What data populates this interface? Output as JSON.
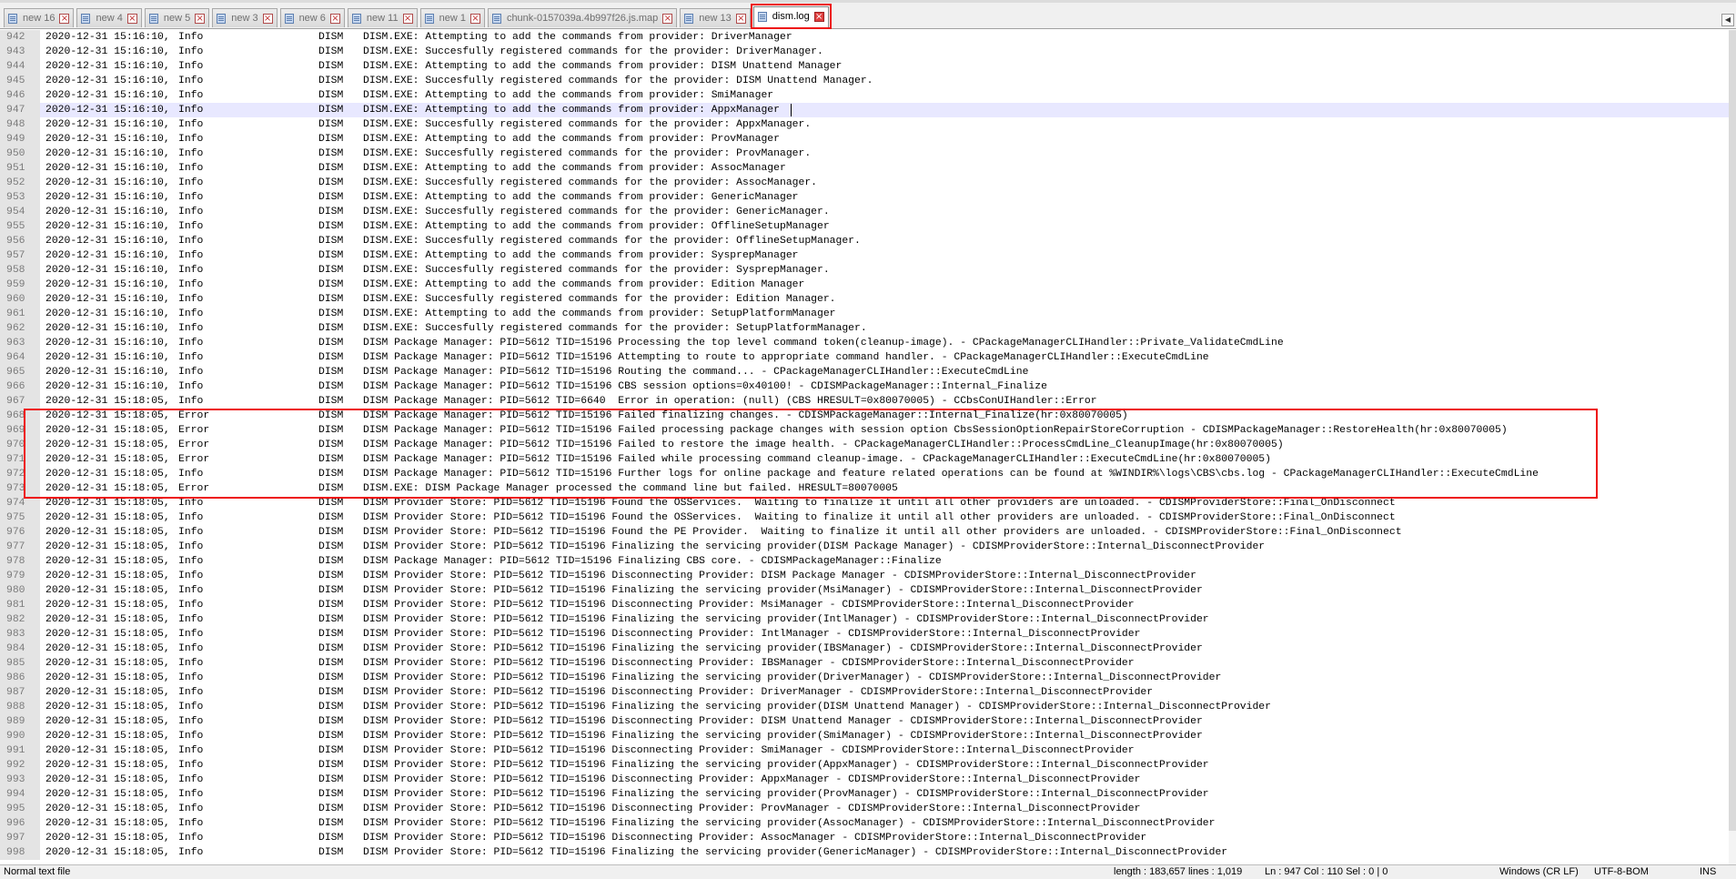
{
  "tabs": [
    {
      "label": "new 16",
      "active": false
    },
    {
      "label": "new 4",
      "active": false
    },
    {
      "label": "new 5",
      "active": false
    },
    {
      "label": "new 3",
      "active": false
    },
    {
      "label": "new 6",
      "active": false
    },
    {
      "label": "new 11",
      "active": false
    },
    {
      "label": "new 1",
      "active": false
    },
    {
      "label": "chunk-0157039a.4b997f26.js.map",
      "active": false
    },
    {
      "label": "new 13",
      "active": false
    },
    {
      "label": "dism.log",
      "active": true
    }
  ],
  "editor": {
    "current_line": 947,
    "lines": [
      {
        "n": "942",
        "dt": "2020-12-31 15:16:10,",
        "lv": "Info",
        "src": "DISM",
        "msg": "DISM.EXE: Attempting to add the commands from provider: DriverManager"
      },
      {
        "n": "943",
        "dt": "2020-12-31 15:16:10,",
        "lv": "Info",
        "src": "DISM",
        "msg": "DISM.EXE: Succesfully registered commands for the provider: DriverManager."
      },
      {
        "n": "944",
        "dt": "2020-12-31 15:16:10,",
        "lv": "Info",
        "src": "DISM",
        "msg": "DISM.EXE: Attempting to add the commands from provider: DISM Unattend Manager"
      },
      {
        "n": "945",
        "dt": "2020-12-31 15:16:10,",
        "lv": "Info",
        "src": "DISM",
        "msg": "DISM.EXE: Succesfully registered commands for the provider: DISM Unattend Manager."
      },
      {
        "n": "946",
        "dt": "2020-12-31 15:16:10,",
        "lv": "Info",
        "src": "DISM",
        "msg": "DISM.EXE: Attempting to add the commands from provider: SmiManager"
      },
      {
        "n": "947",
        "dt": "2020-12-31 15:16:10,",
        "lv": "Info",
        "src": "DISM",
        "msg": "DISM.EXE: Attempting to add the commands from provider: AppxManager"
      },
      {
        "n": "948",
        "dt": "2020-12-31 15:16:10,",
        "lv": "Info",
        "src": "DISM",
        "msg": "DISM.EXE: Succesfully registered commands for the provider: AppxManager."
      },
      {
        "n": "949",
        "dt": "2020-12-31 15:16:10,",
        "lv": "Info",
        "src": "DISM",
        "msg": "DISM.EXE: Attempting to add the commands from provider: ProvManager"
      },
      {
        "n": "950",
        "dt": "2020-12-31 15:16:10,",
        "lv": "Info",
        "src": "DISM",
        "msg": "DISM.EXE: Succesfully registered commands for the provider: ProvManager."
      },
      {
        "n": "951",
        "dt": "2020-12-31 15:16:10,",
        "lv": "Info",
        "src": "DISM",
        "msg": "DISM.EXE: Attempting to add the commands from provider: AssocManager"
      },
      {
        "n": "952",
        "dt": "2020-12-31 15:16:10,",
        "lv": "Info",
        "src": "DISM",
        "msg": "DISM.EXE: Succesfully registered commands for the provider: AssocManager."
      },
      {
        "n": "953",
        "dt": "2020-12-31 15:16:10,",
        "lv": "Info",
        "src": "DISM",
        "msg": "DISM.EXE: Attempting to add the commands from provider: GenericManager"
      },
      {
        "n": "954",
        "dt": "2020-12-31 15:16:10,",
        "lv": "Info",
        "src": "DISM",
        "msg": "DISM.EXE: Succesfully registered commands for the provider: GenericManager."
      },
      {
        "n": "955",
        "dt": "2020-12-31 15:16:10,",
        "lv": "Info",
        "src": "DISM",
        "msg": "DISM.EXE: Attempting to add the commands from provider: OfflineSetupManager"
      },
      {
        "n": "956",
        "dt": "2020-12-31 15:16:10,",
        "lv": "Info",
        "src": "DISM",
        "msg": "DISM.EXE: Succesfully registered commands for the provider: OfflineSetupManager."
      },
      {
        "n": "957",
        "dt": "2020-12-31 15:16:10,",
        "lv": "Info",
        "src": "DISM",
        "msg": "DISM.EXE: Attempting to add the commands from provider: SysprepManager"
      },
      {
        "n": "958",
        "dt": "2020-12-31 15:16:10,",
        "lv": "Info",
        "src": "DISM",
        "msg": "DISM.EXE: Succesfully registered commands for the provider: SysprepManager."
      },
      {
        "n": "959",
        "dt": "2020-12-31 15:16:10,",
        "lv": "Info",
        "src": "DISM",
        "msg": "DISM.EXE: Attempting to add the commands from provider: Edition Manager"
      },
      {
        "n": "960",
        "dt": "2020-12-31 15:16:10,",
        "lv": "Info",
        "src": "DISM",
        "msg": "DISM.EXE: Succesfully registered commands for the provider: Edition Manager."
      },
      {
        "n": "961",
        "dt": "2020-12-31 15:16:10,",
        "lv": "Info",
        "src": "DISM",
        "msg": "DISM.EXE: Attempting to add the commands from provider: SetupPlatformManager"
      },
      {
        "n": "962",
        "dt": "2020-12-31 15:16:10,",
        "lv": "Info",
        "src": "DISM",
        "msg": "DISM.EXE: Succesfully registered commands for the provider: SetupPlatformManager."
      },
      {
        "n": "963",
        "dt": "2020-12-31 15:16:10,",
        "lv": "Info",
        "src": "DISM",
        "msg": "DISM Package Manager: PID=5612 TID=15196 Processing the top level command token(cleanup-image). - CPackageManagerCLIHandler::Private_ValidateCmdLine"
      },
      {
        "n": "964",
        "dt": "2020-12-31 15:16:10,",
        "lv": "Info",
        "src": "DISM",
        "msg": "DISM Package Manager: PID=5612 TID=15196 Attempting to route to appropriate command handler. - CPackageManagerCLIHandler::ExecuteCmdLine"
      },
      {
        "n": "965",
        "dt": "2020-12-31 15:16:10,",
        "lv": "Info",
        "src": "DISM",
        "msg": "DISM Package Manager: PID=5612 TID=15196 Routing the command... - CPackageManagerCLIHandler::ExecuteCmdLine"
      },
      {
        "n": "966",
        "dt": "2020-12-31 15:16:10,",
        "lv": "Info",
        "src": "DISM",
        "msg": "DISM Package Manager: PID=5612 TID=15196 CBS session options=0x40100! - CDISMPackageManager::Internal_Finalize"
      },
      {
        "n": "967",
        "dt": "2020-12-31 15:18:05,",
        "lv": "Info",
        "src": "DISM",
        "msg": "DISM Package Manager: PID=5612 TID=6640  Error in operation: (null) (CBS HRESULT=0x80070005) - CCbsConUIHandler::Error"
      },
      {
        "n": "968",
        "dt": "2020-12-31 15:18:05,",
        "lv": "Error",
        "src": "DISM",
        "msg": "DISM Package Manager: PID=5612 TID=15196 Failed finalizing changes. - CDISMPackageManager::Internal_Finalize(hr:0x80070005)"
      },
      {
        "n": "969",
        "dt": "2020-12-31 15:18:05,",
        "lv": "Error",
        "src": "DISM",
        "msg": "DISM Package Manager: PID=5612 TID=15196 Failed processing package changes with session option CbsSessionOptionRepairStoreCorruption - CDISMPackageManager::RestoreHealth(hr:0x80070005)"
      },
      {
        "n": "970",
        "dt": "2020-12-31 15:18:05,",
        "lv": "Error",
        "src": "DISM",
        "msg": "DISM Package Manager: PID=5612 TID=15196 Failed to restore the image health. - CPackageManagerCLIHandler::ProcessCmdLine_CleanupImage(hr:0x80070005)"
      },
      {
        "n": "971",
        "dt": "2020-12-31 15:18:05,",
        "lv": "Error",
        "src": "DISM",
        "msg": "DISM Package Manager: PID=5612 TID=15196 Failed while processing command cleanup-image. - CPackageManagerCLIHandler::ExecuteCmdLine(hr:0x80070005)"
      },
      {
        "n": "972",
        "dt": "2020-12-31 15:18:05,",
        "lv": "Info",
        "src": "DISM",
        "msg": "DISM Package Manager: PID=5612 TID=15196 Further logs for online package and feature related operations can be found at %WINDIR%\\logs\\CBS\\cbs.log - CPackageManagerCLIHandler::ExecuteCmdLine"
      },
      {
        "n": "973",
        "dt": "2020-12-31 15:18:05,",
        "lv": "Error",
        "src": "DISM",
        "msg": "DISM.EXE: DISM Package Manager processed the command line but failed. HRESULT=80070005"
      },
      {
        "n": "974",
        "dt": "2020-12-31 15:18:05,",
        "lv": "Info",
        "src": "DISM",
        "msg": "DISM Provider Store: PID=5612 TID=15196 Found the OSServices.  Waiting to finalize it until all other providers are unloaded. - CDISMProviderStore::Final_OnDisconnect"
      },
      {
        "n": "975",
        "dt": "2020-12-31 15:18:05,",
        "lv": "Info",
        "src": "DISM",
        "msg": "DISM Provider Store: PID=5612 TID=15196 Found the OSServices.  Waiting to finalize it until all other providers are unloaded. - CDISMProviderStore::Final_OnDisconnect"
      },
      {
        "n": "976",
        "dt": "2020-12-31 15:18:05,",
        "lv": "Info",
        "src": "DISM",
        "msg": "DISM Provider Store: PID=5612 TID=15196 Found the PE Provider.  Waiting to finalize it until all other providers are unloaded. - CDISMProviderStore::Final_OnDisconnect"
      },
      {
        "n": "977",
        "dt": "2020-12-31 15:18:05,",
        "lv": "Info",
        "src": "DISM",
        "msg": "DISM Provider Store: PID=5612 TID=15196 Finalizing the servicing provider(DISM Package Manager) - CDISMProviderStore::Internal_DisconnectProvider"
      },
      {
        "n": "978",
        "dt": "2020-12-31 15:18:05,",
        "lv": "Info",
        "src": "DISM",
        "msg": "DISM Package Manager: PID=5612 TID=15196 Finalizing CBS core. - CDISMPackageManager::Finalize"
      },
      {
        "n": "979",
        "dt": "2020-12-31 15:18:05,",
        "lv": "Info",
        "src": "DISM",
        "msg": "DISM Provider Store: PID=5612 TID=15196 Disconnecting Provider: DISM Package Manager - CDISMProviderStore::Internal_DisconnectProvider"
      },
      {
        "n": "980",
        "dt": "2020-12-31 15:18:05,",
        "lv": "Info",
        "src": "DISM",
        "msg": "DISM Provider Store: PID=5612 TID=15196 Finalizing the servicing provider(MsiManager) - CDISMProviderStore::Internal_DisconnectProvider"
      },
      {
        "n": "981",
        "dt": "2020-12-31 15:18:05,",
        "lv": "Info",
        "src": "DISM",
        "msg": "DISM Provider Store: PID=5612 TID=15196 Disconnecting Provider: MsiManager - CDISMProviderStore::Internal_DisconnectProvider"
      },
      {
        "n": "982",
        "dt": "2020-12-31 15:18:05,",
        "lv": "Info",
        "src": "DISM",
        "msg": "DISM Provider Store: PID=5612 TID=15196 Finalizing the servicing provider(IntlManager) - CDISMProviderStore::Internal_DisconnectProvider"
      },
      {
        "n": "983",
        "dt": "2020-12-31 15:18:05,",
        "lv": "Info",
        "src": "DISM",
        "msg": "DISM Provider Store: PID=5612 TID=15196 Disconnecting Provider: IntlManager - CDISMProviderStore::Internal_DisconnectProvider"
      },
      {
        "n": "984",
        "dt": "2020-12-31 15:18:05,",
        "lv": "Info",
        "src": "DISM",
        "msg": "DISM Provider Store: PID=5612 TID=15196 Finalizing the servicing provider(IBSManager) - CDISMProviderStore::Internal_DisconnectProvider"
      },
      {
        "n": "985",
        "dt": "2020-12-31 15:18:05,",
        "lv": "Info",
        "src": "DISM",
        "msg": "DISM Provider Store: PID=5612 TID=15196 Disconnecting Provider: IBSManager - CDISMProviderStore::Internal_DisconnectProvider"
      },
      {
        "n": "986",
        "dt": "2020-12-31 15:18:05,",
        "lv": "Info",
        "src": "DISM",
        "msg": "DISM Provider Store: PID=5612 TID=15196 Finalizing the servicing provider(DriverManager) - CDISMProviderStore::Internal_DisconnectProvider"
      },
      {
        "n": "987",
        "dt": "2020-12-31 15:18:05,",
        "lv": "Info",
        "src": "DISM",
        "msg": "DISM Provider Store: PID=5612 TID=15196 Disconnecting Provider: DriverManager - CDISMProviderStore::Internal_DisconnectProvider"
      },
      {
        "n": "988",
        "dt": "2020-12-31 15:18:05,",
        "lv": "Info",
        "src": "DISM",
        "msg": "DISM Provider Store: PID=5612 TID=15196 Finalizing the servicing provider(DISM Unattend Manager) - CDISMProviderStore::Internal_DisconnectProvider"
      },
      {
        "n": "989",
        "dt": "2020-12-31 15:18:05,",
        "lv": "Info",
        "src": "DISM",
        "msg": "DISM Provider Store: PID=5612 TID=15196 Disconnecting Provider: DISM Unattend Manager - CDISMProviderStore::Internal_DisconnectProvider"
      },
      {
        "n": "990",
        "dt": "2020-12-31 15:18:05,",
        "lv": "Info",
        "src": "DISM",
        "msg": "DISM Provider Store: PID=5612 TID=15196 Finalizing the servicing provider(SmiManager) - CDISMProviderStore::Internal_DisconnectProvider"
      },
      {
        "n": "991",
        "dt": "2020-12-31 15:18:05,",
        "lv": "Info",
        "src": "DISM",
        "msg": "DISM Provider Store: PID=5612 TID=15196 Disconnecting Provider: SmiManager - CDISMProviderStore::Internal_DisconnectProvider"
      },
      {
        "n": "992",
        "dt": "2020-12-31 15:18:05,",
        "lv": "Info",
        "src": "DISM",
        "msg": "DISM Provider Store: PID=5612 TID=15196 Finalizing the servicing provider(AppxManager) - CDISMProviderStore::Internal_DisconnectProvider"
      },
      {
        "n": "993",
        "dt": "2020-12-31 15:18:05,",
        "lv": "Info",
        "src": "DISM",
        "msg": "DISM Provider Store: PID=5612 TID=15196 Disconnecting Provider: AppxManager - CDISMProviderStore::Internal_DisconnectProvider"
      },
      {
        "n": "994",
        "dt": "2020-12-31 15:18:05,",
        "lv": "Info",
        "src": "DISM",
        "msg": "DISM Provider Store: PID=5612 TID=15196 Finalizing the servicing provider(ProvManager) - CDISMProviderStore::Internal_DisconnectProvider"
      },
      {
        "n": "995",
        "dt": "2020-12-31 15:18:05,",
        "lv": "Info",
        "src": "DISM",
        "msg": "DISM Provider Store: PID=5612 TID=15196 Disconnecting Provider: ProvManager - CDISMProviderStore::Internal_DisconnectProvider"
      },
      {
        "n": "996",
        "dt": "2020-12-31 15:18:05,",
        "lv": "Info",
        "src": "DISM",
        "msg": "DISM Provider Store: PID=5612 TID=15196 Finalizing the servicing provider(AssocManager) - CDISMProviderStore::Internal_DisconnectProvider"
      },
      {
        "n": "997",
        "dt": "2020-12-31 15:18:05,",
        "lv": "Info",
        "src": "DISM",
        "msg": "DISM Provider Store: PID=5612 TID=15196 Disconnecting Provider: AssocManager - CDISMProviderStore::Internal_DisconnectProvider"
      },
      {
        "n": "998",
        "dt": "2020-12-31 15:18:05,",
        "lv": "Info",
        "src": "DISM",
        "msg": "DISM Provider Store: PID=5612 TID=15196 Finalizing the servicing provider(GenericManager) - CDISMProviderStore::Internal_DisconnectProvider"
      }
    ]
  },
  "statusbar": {
    "file_type": "Normal text file",
    "length": "length : 183,657    lines : 1,019",
    "position": "Ln : 947    Col : 110    Sel : 0 | 0",
    "eol": "Windows (CR LF)",
    "encoding": "UTF-8-BOM",
    "mode": "INS"
  },
  "colors": {
    "highlight_box": "#ee1111",
    "current_line_bg": "#e8e8ff",
    "gutter_bg": "#e4e4e4"
  }
}
